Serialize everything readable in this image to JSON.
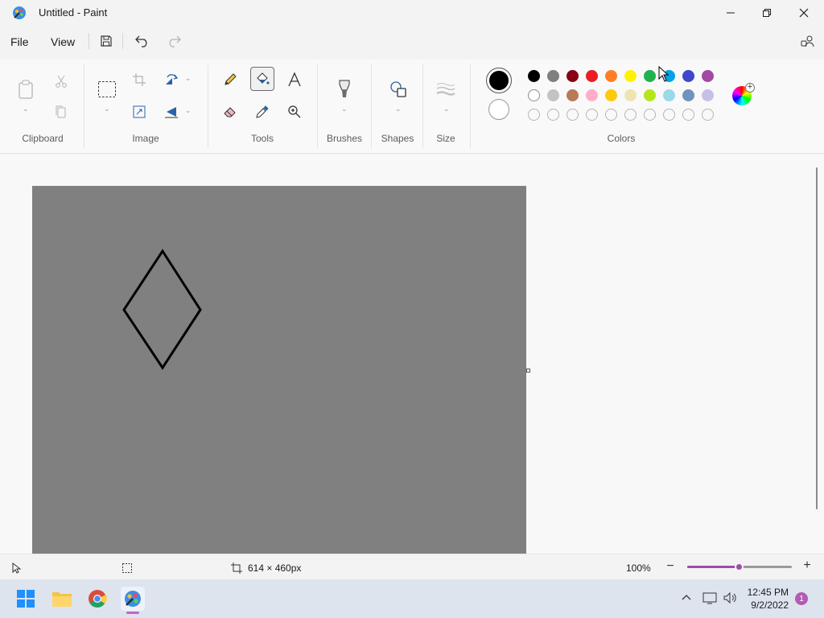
{
  "window": {
    "title": "Untitled - Paint"
  },
  "menu": {
    "file": "File",
    "view": "View"
  },
  "ribbon": {
    "groups": {
      "clipboard": "Clipboard",
      "image": "Image",
      "tools": "Tools",
      "brushes": "Brushes",
      "shapes": "Shapes",
      "size": "Size",
      "colors": "Colors"
    },
    "active_tool": "fill-bucket",
    "color1": "#000000",
    "color2": "#ffffff",
    "palette_row1": [
      "#000000",
      "#7f7f7f",
      "#880015",
      "#ed1c24",
      "#ff7f27",
      "#fff200",
      "#22b14c",
      "#00a2e8",
      "#3f48cc",
      "#a349a4"
    ],
    "palette_row2": [
      "#ffffff",
      "#c3c3c3",
      "#b97a57",
      "#ffaec9",
      "#ffc90e",
      "#efe4b0",
      "#b5e61d",
      "#99d9ea",
      "#7092be",
      "#c8bfe7"
    ]
  },
  "canvas": {
    "background": "#808080",
    "shape": "diamond"
  },
  "status": {
    "canvas_size": "614 × 460px",
    "zoom": "100%",
    "zoom_level": 0.5
  },
  "taskbar": {
    "time": "12:45 PM",
    "date": "9/2/2022",
    "notifications": "1"
  }
}
